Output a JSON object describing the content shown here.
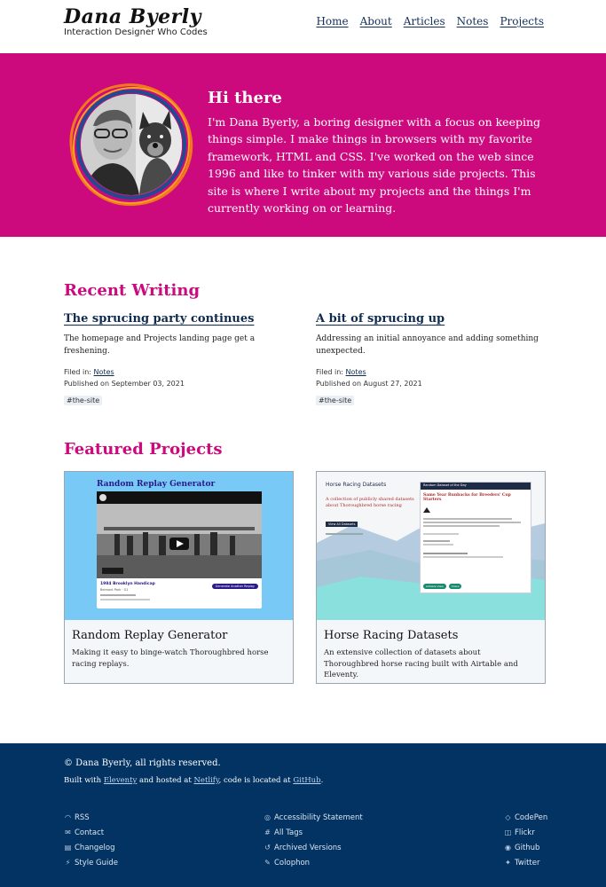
{
  "header": {
    "logo": "Dana Byerly",
    "tagline": "Interaction Designer Who Codes",
    "nav": [
      "Home",
      "About",
      "Articles",
      "Notes",
      "Projects"
    ]
  },
  "hero": {
    "title": "Hi there",
    "text": "I'm Dana Byerly, a boring designer with a focus on keeping things simple. I make things in browsers with my favorite framework, HTML and CSS. I've worked on the web since 1996 and like to tinker with my various side projects. This site is where I write about my projects and the things I'm currently working on or learning."
  },
  "recent": {
    "title": "Recent Writing",
    "posts": [
      {
        "title": "The sprucing party continues",
        "excerpt": "The homepage and Projects landing page get a freshening.",
        "filed_label": "Filed in:",
        "filed": "Notes",
        "published": "Published on September 03, 2021",
        "tag": "#the-site"
      },
      {
        "title": "A bit of sprucing up",
        "excerpt": "Addressing an initial annoyance and adding something unexpected.",
        "filed_label": "Filed in:",
        "filed": "Notes",
        "published": "Published on August 27, 2021",
        "tag": "#the-site"
      }
    ]
  },
  "projects": {
    "title": "Featured Projects",
    "items": [
      {
        "title": "Random Replay Generator",
        "desc": "Making it easy to binge-watch Thoroughbred horse racing replays.",
        "thumb": {
          "heading": "Random Replay Generator",
          "race": "1984 Brooklyn Handicap",
          "race_sub": "Belmont Park · G1",
          "button": "Generate Another Replay"
        }
      },
      {
        "title": "Horse Racing Datasets",
        "desc": "An extensive collection of datasets about Thoroughbred horse racing built with Airtable and Eleventy.",
        "thumb": {
          "heading": "Horse Racing Datasets",
          "tagline": "A collection of publicly shared datasets about Thoroughbred horse racing",
          "button": "View All Datasets",
          "card_bar": "Random Dataset of the Day",
          "card_title": "Same Year Runbacks for Breeders' Cup Starters",
          "chip1": "Airtable View",
          "chip2": "Share"
        }
      }
    ]
  },
  "footer": {
    "copyright": "© Dana Byerly, all rights reserved.",
    "built_prefix": "Built with ",
    "built_link1": "Eleventy",
    "built_mid": " and hosted at ",
    "built_link2": "Netlify",
    "built_mid2": ", code is located at ",
    "built_link3": "GitHub",
    "built_end": ".",
    "col1": [
      {
        "icon": "rss-icon",
        "label": "RSS"
      },
      {
        "icon": "mail-icon",
        "label": "Contact"
      },
      {
        "icon": "changelog-icon",
        "label": "Changelog"
      },
      {
        "icon": "style-icon",
        "label": "Style Guide"
      }
    ],
    "col2": [
      {
        "icon": "accessibility-icon",
        "label": "Accessibility Statement"
      },
      {
        "icon": "hashtag-icon",
        "label": "All Tags"
      },
      {
        "icon": "history-icon",
        "label": "Archived Versions"
      },
      {
        "icon": "colophon-icon",
        "label": "Colophon"
      }
    ],
    "col3": [
      {
        "icon": "codepen-icon",
        "label": "CodePen"
      },
      {
        "icon": "flickr-icon",
        "label": "Flickr"
      },
      {
        "icon": "github-icon",
        "label": "Github"
      },
      {
        "icon": "twitter-icon",
        "label": "Twitter"
      }
    ]
  },
  "colors": {
    "accent": "#cc0a7e",
    "footer_bg": "#033362",
    "link": "#0f2b4f"
  }
}
